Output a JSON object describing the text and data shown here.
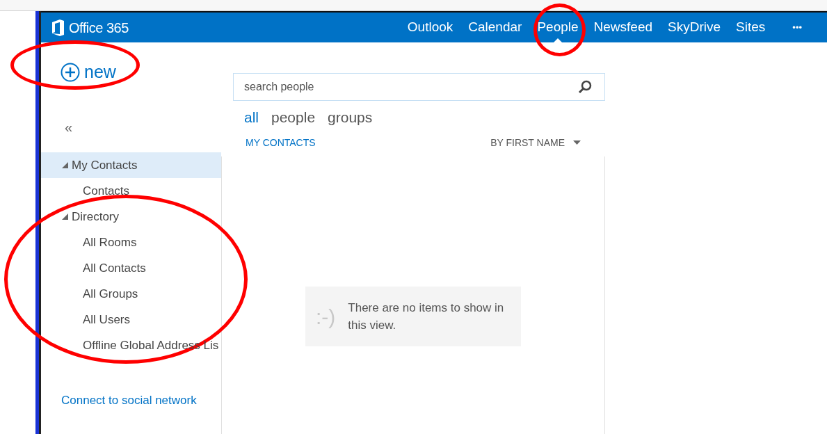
{
  "header": {
    "brand": "Office 365",
    "nav": [
      {
        "label": "Outlook",
        "selected": false
      },
      {
        "label": "Calendar",
        "selected": false
      },
      {
        "label": "People",
        "selected": true
      },
      {
        "label": "Newsfeed",
        "selected": false
      },
      {
        "label": "SkyDrive",
        "selected": false
      },
      {
        "label": "Sites",
        "selected": false
      }
    ],
    "more": "•••"
  },
  "sidebar": {
    "new_label": "new",
    "collapse": "«",
    "tree": [
      {
        "label": "My Contacts",
        "expanded": true,
        "selected": true,
        "children": [
          {
            "label": "Contacts",
            "selected": false
          }
        ]
      },
      {
        "label": "Directory",
        "expanded": true,
        "selected": false,
        "children": [
          {
            "label": "All Rooms",
            "selected": false
          },
          {
            "label": "All Contacts",
            "selected": false
          },
          {
            "label": "All Groups",
            "selected": false
          },
          {
            "label": "All Users",
            "selected": false
          },
          {
            "label": "Offline Global Address Lis",
            "selected": false
          }
        ]
      }
    ],
    "social_link": "Connect to social network"
  },
  "search": {
    "placeholder": "search people"
  },
  "filters": [
    {
      "label": "all",
      "selected": true
    },
    {
      "label": "people",
      "selected": false
    },
    {
      "label": "groups",
      "selected": false
    }
  ],
  "list": {
    "title": "MY CONTACTS",
    "sort": "BY FIRST NAME",
    "empty_face": ":-)",
    "empty_message": "There are no items to show in this view."
  }
}
